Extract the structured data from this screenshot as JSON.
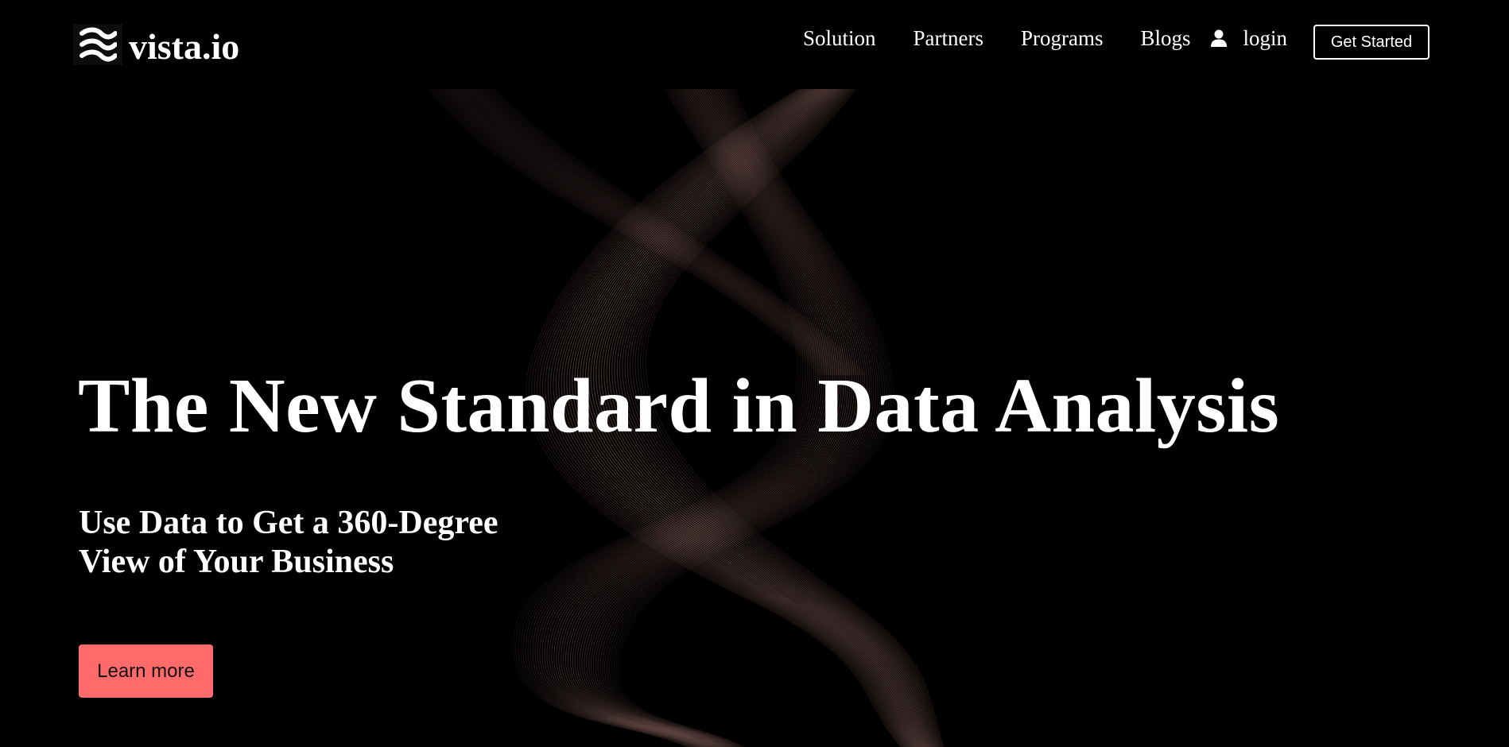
{
  "brand": {
    "name": "vista.io",
    "logo_icon": "wave-lines-icon"
  },
  "nav": {
    "items": [
      {
        "label": "Solution"
      },
      {
        "label": "Partners"
      },
      {
        "label": "Programs"
      },
      {
        "label": "Blogs"
      }
    ],
    "user_icon": "user-icon",
    "login_label": "login",
    "cta_label": "Get Started"
  },
  "hero": {
    "title": "The New Standard in Data Analysis",
    "subtitle_line1": "Use Data to Get a 360-Degree",
    "subtitle_line2": "View of Your Business",
    "button_label": "Learn more"
  },
  "colors": {
    "background": "#000000",
    "text": "#ffffff",
    "accent": "#ff6b6b",
    "wave": "#e8a8a0"
  }
}
